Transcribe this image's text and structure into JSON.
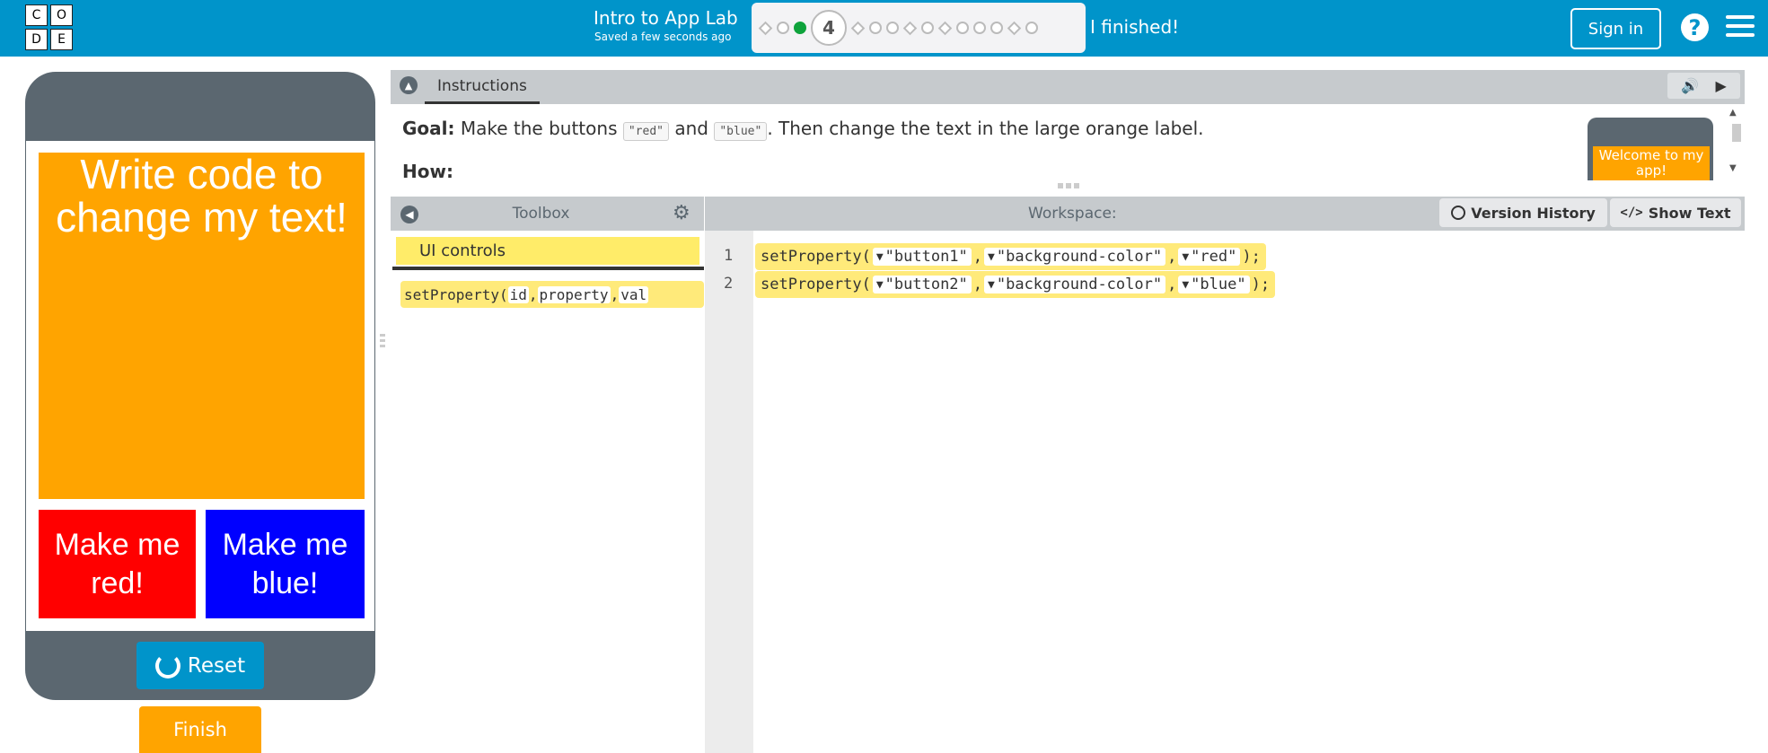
{
  "header": {
    "logo_letters": [
      "C",
      "O",
      "D",
      "E"
    ],
    "lesson_title": "Intro to App Lab",
    "saved_text": "Saved a few seconds ago",
    "current_level": "4",
    "finished_label": "I finished!",
    "signin_label": "Sign in",
    "help_glyph": "?",
    "colors": {
      "bar": "#0094ca",
      "progress_done": "#0fa33c"
    }
  },
  "app": {
    "orange_label_text": "Write code to change my text!",
    "red_button_text": "Make me red!",
    "blue_button_text": "Make me blue!",
    "reset_label": "Reset",
    "finish_label": "Finish",
    "colors": {
      "orange": "#ffa400",
      "red": "#ff0000",
      "blue": "#0000ff",
      "phone": "#5b6770"
    }
  },
  "instructions": {
    "tab_label": "Instructions",
    "goal_label": "Goal:",
    "goal_pre": "Make the buttons",
    "chip_red": "\"red\"",
    "goal_and": "and",
    "chip_blue": "\"blue\"",
    "goal_post": ". Then change the text in the large orange label.",
    "how_label": "How:",
    "thumbnail_text": "Welcome to my app!",
    "audio_icon": "speaker-icon",
    "play_icon": "play-icon"
  },
  "toolbox": {
    "title": "Toolbox",
    "category": "UI controls",
    "block_name": "setProperty(",
    "block_param1": "id",
    "block_param2": "property",
    "block_param3": "val"
  },
  "workspace": {
    "title": "Workspace:",
    "version_history_label": "Version History",
    "show_text_label": "Show Text",
    "code_lines": [
      {
        "num": "1",
        "fn": "setProperty(",
        "arg1": "\"button1\"",
        "arg2": "\"background-color\"",
        "arg3": "\"red\"",
        "end": ");"
      },
      {
        "num": "2",
        "fn": "setProperty(",
        "arg1": "\"button2\"",
        "arg2": "\"background-color\"",
        "arg3": "\"blue\"",
        "end": ");"
      }
    ]
  }
}
